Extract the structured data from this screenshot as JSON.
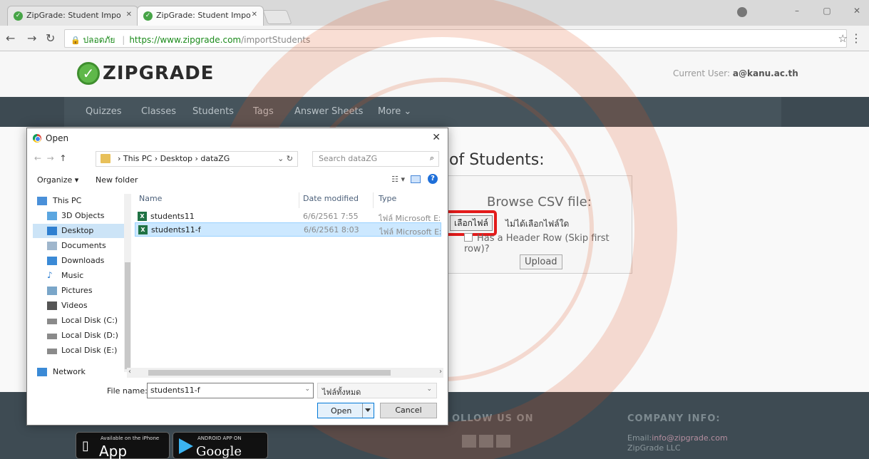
{
  "browser": {
    "tabs": [
      {
        "label": "ZipGrade: Student Impo"
      },
      {
        "label": "ZipGrade: Student Impo"
      }
    ],
    "address": {
      "secure_label": "ปลอดภัย",
      "host": "https://www.zipgrade.com",
      "path": "/importStudents"
    }
  },
  "site": {
    "logo_text": "ZIPGRADE",
    "current_user_label": "Current User:",
    "current_user": "a@kanu.ac.th",
    "nav": [
      "Quizzes",
      "Classes",
      "Students",
      "Tags",
      "Answer Sheets",
      "More ⌄"
    ],
    "import_title": "of Students:",
    "upload": {
      "browse_title": "Browse CSV file:",
      "choose_file": "เลือกไฟล์",
      "no_file": "ไม่ได้เลือกไฟล์ใด",
      "header_row": "Has a Header Row (Skip first row)?",
      "upload_button": "Upload"
    },
    "footer": {
      "follow": "OLLOW US ON",
      "company": "COMPANY INFO:",
      "email_label": "Email:",
      "email": "info@zipgrade.com",
      "llc": "ZipGrade LLC",
      "apple_small": "Available on the iPhone",
      "apple_big": "App Store",
      "google_small": "ANDROID APP ON",
      "google_big": "Google play"
    }
  },
  "dialog": {
    "title": "Open",
    "path": [
      "This PC",
      "Desktop",
      "dataZG"
    ],
    "search_placeholder": "Search dataZG",
    "organize": "Organize ▾",
    "new_folder": "New folder",
    "nav_items": [
      {
        "label": "This PC",
        "level": 0
      },
      {
        "label": "3D Objects",
        "level": 1
      },
      {
        "label": "Desktop",
        "level": 1,
        "selected": true
      },
      {
        "label": "Documents",
        "level": 1
      },
      {
        "label": "Downloads",
        "level": 1
      },
      {
        "label": "Music",
        "level": 1
      },
      {
        "label": "Pictures",
        "level": 1
      },
      {
        "label": "Videos",
        "level": 1
      },
      {
        "label": "Local Disk (C:)",
        "level": 1
      },
      {
        "label": "Local Disk (D:)",
        "level": 1
      },
      {
        "label": "Local Disk (E:)",
        "level": 1
      },
      {
        "label": "Network",
        "level": 0
      }
    ],
    "columns": {
      "name": "Name",
      "date": "Date modified",
      "type": "Type"
    },
    "files": [
      {
        "name": "students11",
        "date": "6/6/2561 7:55",
        "type": "ไฟล์ Microsoft Exc...",
        "selected": false
      },
      {
        "name": "students11-f",
        "date": "6/6/2561 8:03",
        "type": "ไฟล์ Microsoft Exc...",
        "selected": true
      }
    ],
    "file_name_label": "File name:",
    "file_name_value": "students11-f",
    "filter_value": "ไฟล์ทั้งหมด",
    "open_button": "Open",
    "cancel_button": "Cancel"
  }
}
